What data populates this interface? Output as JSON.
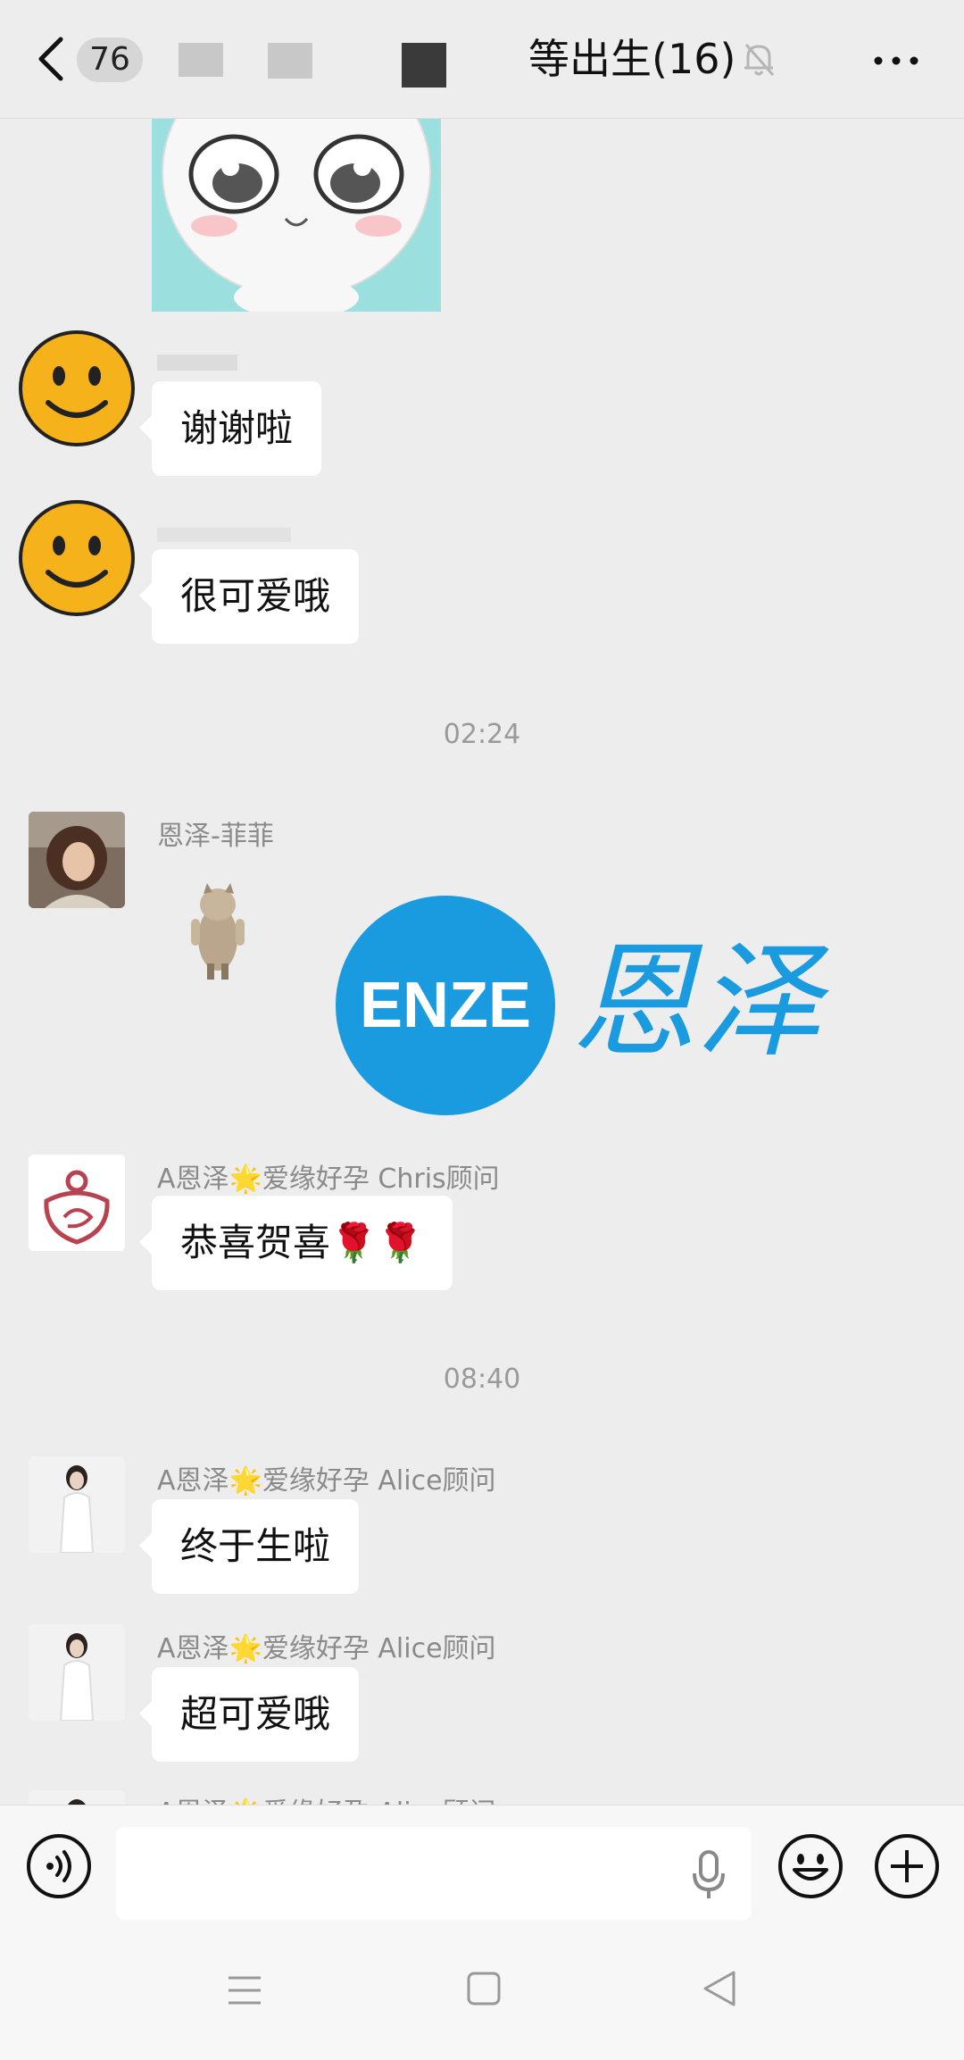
{
  "header": {
    "back_count": "76",
    "title": "等出生(16)"
  },
  "messages": [
    {
      "text": "谢谢啦"
    },
    {
      "text": "很可爱哦"
    },
    {
      "time": "02:24"
    },
    {
      "sender": "恩泽-菲菲"
    },
    {
      "sender": "A恩泽🌟爱缘好孕 Chris顾问",
      "text": "恭喜贺喜🌹🌹"
    },
    {
      "time": "08:40"
    },
    {
      "sender": "A恩泽🌟爱缘好孕 Alice顾问",
      "text": "终于生啦"
    },
    {
      "sender": "A恩泽🌟爱缘好孕 Alice顾问",
      "text": "超可爱哦"
    },
    {
      "sender": "A恩泽🌟爱缘好孕 Alice顾问"
    }
  ],
  "watermark": {
    "logo_text": "ENZE",
    "brand_text": "恩泽",
    "brand_color": "#1a9be0"
  },
  "icons": {
    "voice": "voice-input-icon",
    "mic": "microphone-icon",
    "emoji": "emoji-icon",
    "plus": "plus-icon"
  }
}
